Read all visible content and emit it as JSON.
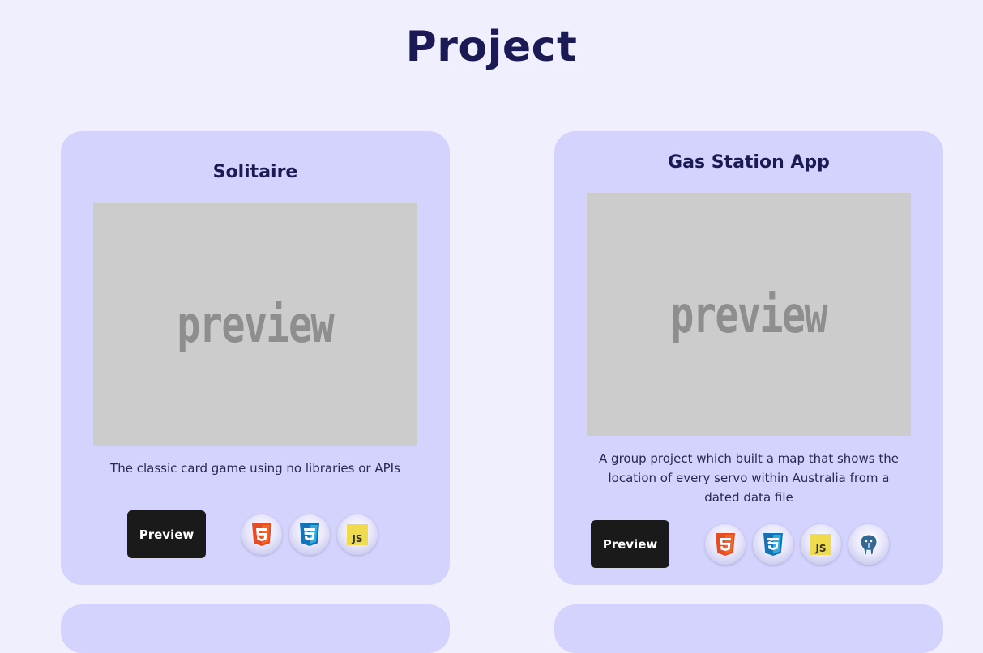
{
  "page": {
    "title": "Project"
  },
  "projects": [
    {
      "title": "Solitaire",
      "preview_text": "preview",
      "description": "The classic card game using no libraries or APIs",
      "button_label": "Preview",
      "tech": [
        "html5-icon",
        "css3-icon",
        "javascript-icon"
      ]
    },
    {
      "title": "Gas Station App",
      "preview_text": "preview",
      "description": "A group project which built a map that shows the location of every servo within Australia from a dated data file",
      "button_label": "Preview",
      "tech": [
        "html5-icon",
        "css3-icon",
        "javascript-icon",
        "postgresql-icon"
      ]
    }
  ],
  "colors": {
    "background": "#f0effd",
    "card": "#d4d3fd",
    "title": "#1c1a54",
    "preview_bg": "#cccccc",
    "button": "#1a1a1a",
    "html5": "#e44d26",
    "css3": "#1572b6",
    "javascript": "#f0db4f",
    "postgresql": "#336791"
  }
}
